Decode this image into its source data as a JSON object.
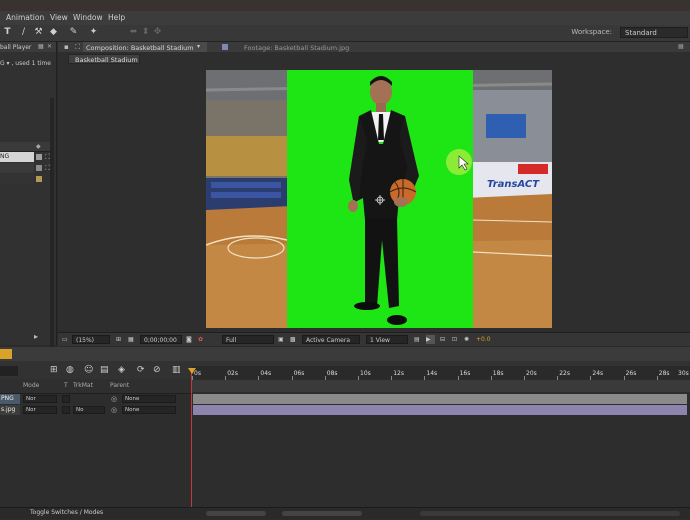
{
  "menu": {
    "items": [
      "Animation",
      "View",
      "Window",
      "Help"
    ]
  },
  "toolbar": {
    "workspace_label": "Workspace:",
    "workspace_value": "Standard"
  },
  "left_panel": {
    "header_text": "ball Player",
    "sub_text": "G ▾ , used 1 time",
    "item_label": "NG"
  },
  "comp_panel": {
    "composition_tab": "Composition: Basketball Stadium",
    "footage_tab": "Footage: Basketball Stadium.jpg",
    "breadcrumb": "Basketball Stadium"
  },
  "viewer": {
    "jersey_text": "TransACT",
    "green_screen_color": "#1ee614"
  },
  "viewer_bar": {
    "zoom": "(15%)",
    "timecode": "0;00;00;00",
    "resolution": "Full",
    "camera": "Active Camera",
    "views": "1 View",
    "exposure": "+0.0"
  },
  "timeline": {
    "columns": [
      "Mode",
      "T",
      "TrkMat",
      "Parent"
    ],
    "ruler_ticks": [
      "0s",
      "02s",
      "04s",
      "06s",
      "08s",
      "10s",
      "12s",
      "14s",
      "16s",
      "18s",
      "20s",
      "22s",
      "24s",
      "26s",
      "28s",
      "30s"
    ],
    "layers": [
      {
        "name": "PNG",
        "mode": "Nor",
        "trkmat": "",
        "parent": "None",
        "color": "#8a8a8a"
      },
      {
        "name": "s.jpg",
        "mode": "Nor",
        "trkmat": "No",
        "parent": "None",
        "color": "#8d84b0"
      }
    ]
  },
  "bottom_bar": {
    "toggle_label": "Toggle Switches / Modes"
  },
  "colors": {
    "accent": "#d9a22a",
    "playhead": "#c43a3a"
  }
}
